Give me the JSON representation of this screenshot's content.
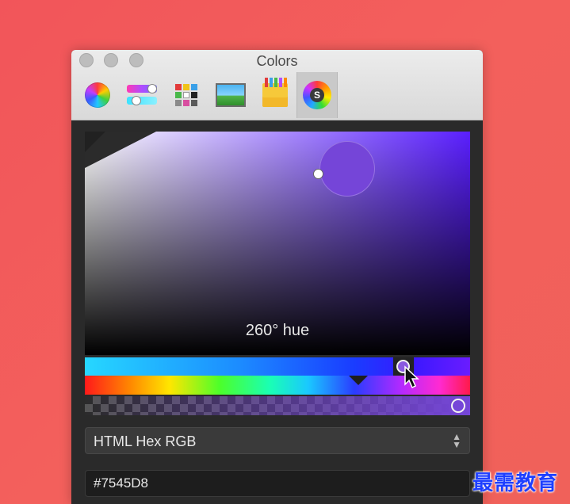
{
  "window": {
    "title": "Colors"
  },
  "toolbar": {
    "tabs": [
      {
        "icon": "color-wheel-icon"
      },
      {
        "icon": "color-sliders-icon"
      },
      {
        "icon": "color-palettes-icon"
      },
      {
        "icon": "image-palettes-icon"
      },
      {
        "icon": "crayons-icon"
      },
      {
        "icon": "spectrum-plugin-icon",
        "active": true
      }
    ]
  },
  "picker": {
    "hue_label": "260° hue",
    "hue_degrees": 260,
    "selected_color": "#7545D8"
  },
  "format_select": {
    "value": "HTML Hex RGB"
  },
  "hex_input": {
    "value": "#7545D8"
  },
  "colors": {
    "background": "#f2555a",
    "selected": "#7545d8"
  },
  "watermark": "最需教育"
}
